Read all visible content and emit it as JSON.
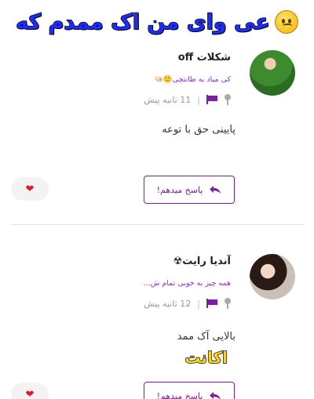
{
  "banner": {
    "text": "عی وای من اک ممدم که",
    "emoji": "worried-face"
  },
  "comments": [
    {
      "username": "شکلات off",
      "bio": "کی میاد به طانتچی🙂🤜🏻",
      "time": "11 ثانیه پیش",
      "body": "پایینی حق با توعه",
      "reply_label": "پاسخ میدهم!",
      "like_icon": "heart"
    },
    {
      "username": "آندیا رایت☢",
      "bio": "همه چیز به خوبی تمام ش...",
      "time": "12 ثانیه پیش",
      "body": "بالایی آک ممد",
      "overlay": "اکانت",
      "reply_label": "پاسخ میدهم!",
      "like_icon": "heart"
    }
  ],
  "colors": {
    "accent": "#7a1fa2",
    "banner_text": "#1e2bff",
    "overlay_text": "#ffd21a",
    "heart": "#e0142c"
  }
}
